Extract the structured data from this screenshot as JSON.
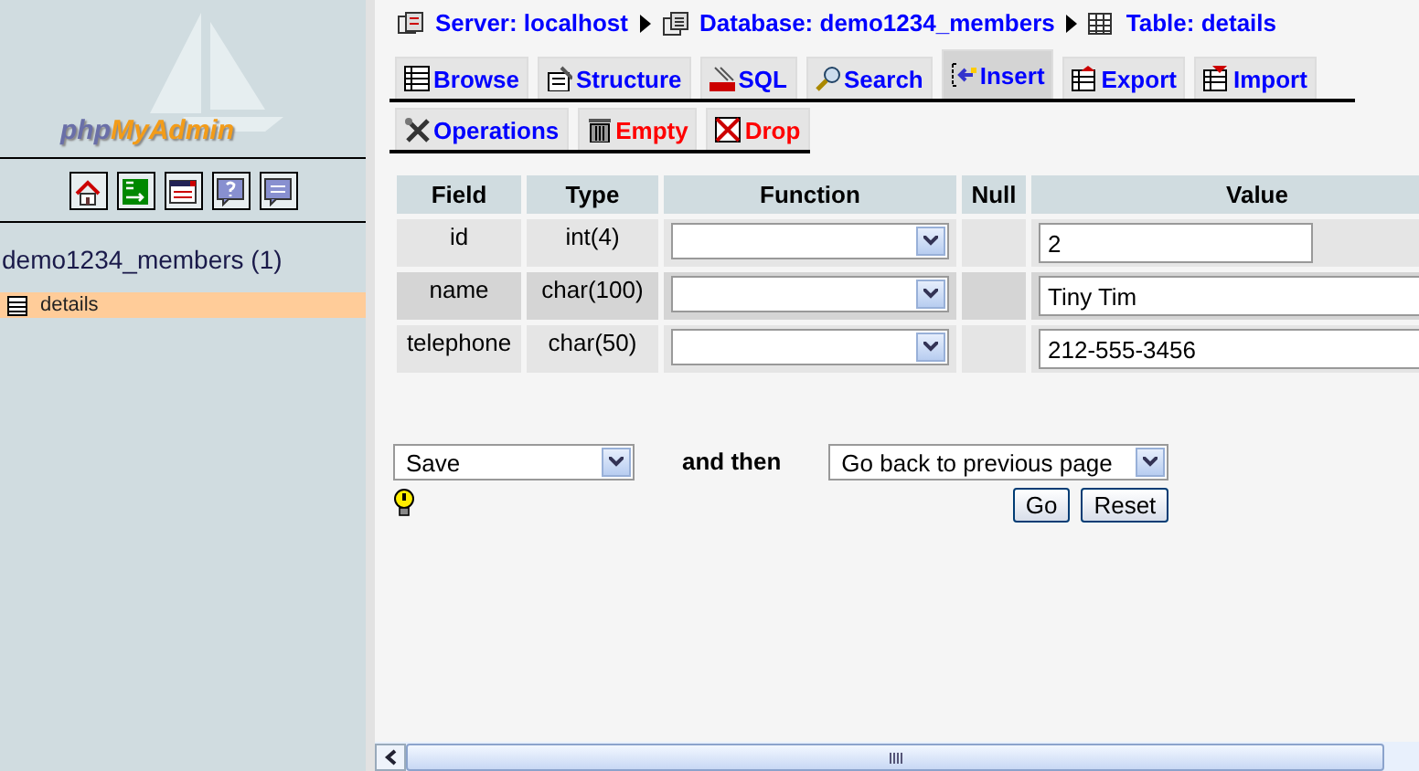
{
  "sidebar": {
    "logo": [
      "php",
      "MyAdmin"
    ],
    "icons": [
      {
        "kind": "home"
      },
      {
        "kind": "exit"
      },
      {
        "kind": "sql-window"
      },
      {
        "kind": "help"
      },
      {
        "kind": "sql-query"
      }
    ],
    "database": "demo1234_members (1)",
    "tables": [
      {
        "label": "details",
        "selected": true
      }
    ]
  },
  "breadcrumb": [
    {
      "kind": "server",
      "label": "Server: localhost"
    },
    {
      "kind": "database",
      "label": "Database: demo1234_members"
    },
    {
      "kind": "table",
      "label": "Table: details"
    }
  ],
  "tabs": [
    [
      {
        "kind": "browse",
        "label": "Browse",
        "selected": false,
        "danger": false
      },
      {
        "kind": "structure",
        "label": "Structure",
        "selected": false,
        "danger": false
      },
      {
        "kind": "sql",
        "label": "SQL",
        "selected": false,
        "danger": false
      },
      {
        "kind": "search",
        "label": "Search",
        "selected": false,
        "danger": false
      },
      {
        "kind": "insert",
        "label": "Insert",
        "selected": true,
        "danger": false
      },
      {
        "kind": "export",
        "label": "Export",
        "selected": false,
        "danger": false
      },
      {
        "kind": "import",
        "label": "Import",
        "selected": false,
        "danger": false
      }
    ],
    [
      {
        "kind": "operations",
        "label": "Operations",
        "selected": false,
        "danger": false
      },
      {
        "kind": "empty",
        "label": "Empty",
        "selected": false,
        "danger": true
      },
      {
        "kind": "drop",
        "label": "Drop",
        "selected": false,
        "danger": true
      }
    ]
  ],
  "table": {
    "columns": [
      "Field",
      "Type",
      "Function",
      "Null",
      "Value"
    ],
    "rows": [
      {
        "field": "id",
        "type": "int(4)",
        "value": "2",
        "highlighted": false,
        "wide": false
      },
      {
        "field": "name",
        "type": "char(100)",
        "value": "Tiny Tim",
        "highlighted": true,
        "wide": true
      },
      {
        "field": "telephone",
        "type": "char(50)",
        "value": "212-555-3456",
        "highlighted": false,
        "wide": true
      }
    ]
  },
  "action": {
    "value": "Save"
  },
  "connector": "and then",
  "after": {
    "value": "Go back to previous page"
  },
  "buttons": [
    "Go",
    "Reset"
  ]
}
